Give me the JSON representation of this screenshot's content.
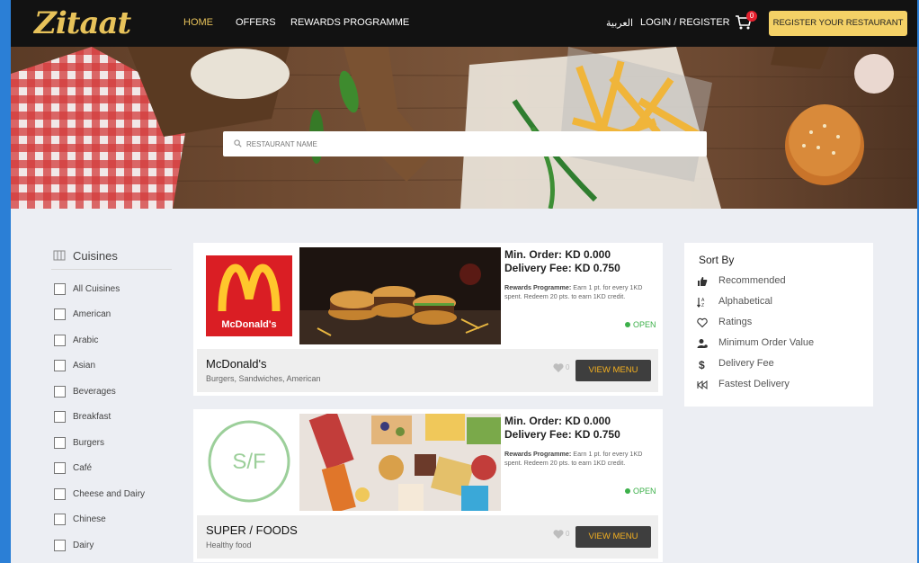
{
  "nav": {
    "logo": "Zitaat",
    "links": [
      "HOME",
      "OFFERS",
      "REWARDS PROGRAMME"
    ],
    "arabic": "العربية",
    "login": "LOGIN / REGISTER",
    "cart_count": "0",
    "register": "REGISTER YOUR RESTAURANT"
  },
  "search": {
    "placeholder": "RESTAURANT NAME"
  },
  "sidebar": {
    "title": "Cuisines",
    "items": [
      "All Cuisines",
      "American",
      "Arabic",
      "Asian",
      "Beverages",
      "Breakfast",
      "Burgers",
      "Café",
      "Cheese and Dairy",
      "Chinese",
      "Dairy"
    ]
  },
  "restaurants": [
    {
      "logo_text": "McDonald's",
      "min_order": "Min. Order: KD 0.000",
      "delivery_fee": "Delivery Fee: KD 0.750",
      "rewards_label": "Rewards Programme:",
      "rewards_text": "Earn 1 pt. for every 1KD spent. Redeem 20 pts. to earn 1KD credit.",
      "status": "OPEN",
      "name": "McDonald's",
      "tags": "Burgers, Sandwiches, American",
      "likes": "0",
      "button": "VIEW MENU"
    },
    {
      "logo_text": "S/F",
      "min_order": "Min. Order: KD 0.000",
      "delivery_fee": "Delivery Fee: KD 0.750",
      "rewards_label": "Rewards Programme:",
      "rewards_text": "Earn 1 pt. for every 1KD spent. Redeem 20 pts. to earn 1KD credit.",
      "status": "OPEN",
      "name": "SUPER / FOODS",
      "tags": "Healthy food",
      "likes": "0",
      "button": "VIEW MENU"
    }
  ],
  "sort": {
    "title": "Sort By",
    "items": [
      "Recommended",
      "Alphabetical",
      "Ratings",
      "Minimum Order Value",
      "Delivery Fee",
      "Fastest Delivery"
    ]
  },
  "colors": {
    "accent": "#e7c25a",
    "nav_bg": "#121212",
    "open": "#3cb04a",
    "button_text": "#f4b020"
  }
}
